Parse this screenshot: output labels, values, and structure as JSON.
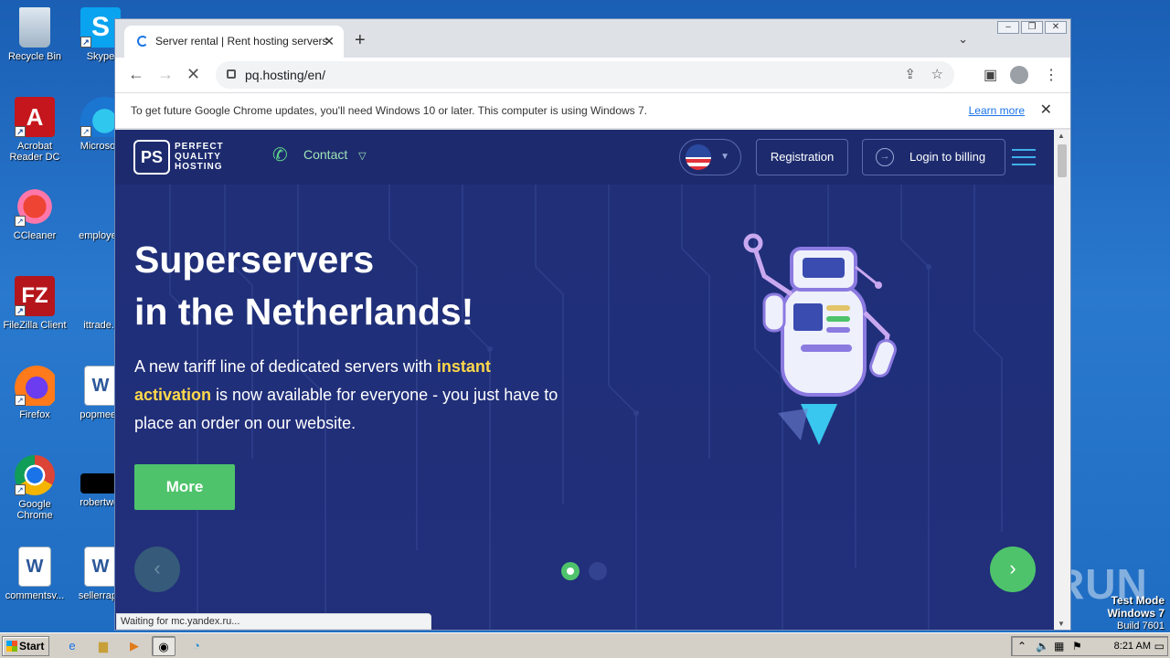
{
  "desktop": {
    "icons": [
      {
        "label": "Recycle Bin"
      },
      {
        "label": "Skype"
      },
      {
        "label": "Acrobat Reader DC"
      },
      {
        "label": "Microsoft"
      },
      {
        "label": "CCleaner"
      },
      {
        "label": "employee"
      },
      {
        "label": "FileZilla Client"
      },
      {
        "label": "ittrade.r"
      },
      {
        "label": "Firefox"
      },
      {
        "label": "popmeeti"
      },
      {
        "label": "Google Chrome"
      },
      {
        "label": "robertwel"
      },
      {
        "label": "commentsv..."
      },
      {
        "label": "sellerrapp"
      }
    ],
    "test_mode": {
      "line1": "Test Mode",
      "line2": "Windows 7",
      "line3": "Build 7601"
    },
    "watermark": "ANY RUN"
  },
  "taskbar": {
    "start_label": "Start",
    "clock": "8:21 AM"
  },
  "browser": {
    "tab": {
      "title": "Server rental | Rent hosting servers"
    },
    "url": "pq.hosting/en/",
    "infobar": {
      "message": "To get future Google Chrome updates, you'll need Windows 10 or later. This computer is using Windows 7.",
      "link": "Learn more"
    },
    "status": "Waiting for mc.yandex.ru..."
  },
  "site": {
    "logo": {
      "mark": "PS",
      "line1": "PERFECT",
      "line2": "QUALITY",
      "line3": "HOSTING"
    },
    "contact_label": "Contact",
    "registration_label": "Registration",
    "login_label": "Login to billing",
    "hero": {
      "title_line1": "Superservers",
      "title_line2": "in the Netherlands!",
      "desc_a": "A new tariff line of dedicated servers with ",
      "desc_highlight1": "instant",
      "desc_highlight2": "activation",
      "desc_b": " is now available for everyone - you just have to place an order on our website.",
      "cta": "More"
    },
    "slider": {
      "active_index": 1,
      "count": 2
    },
    "colors": {
      "accent_green": "#4ec36b",
      "background": "#222f7a",
      "highlight": "#ffd84a"
    }
  }
}
